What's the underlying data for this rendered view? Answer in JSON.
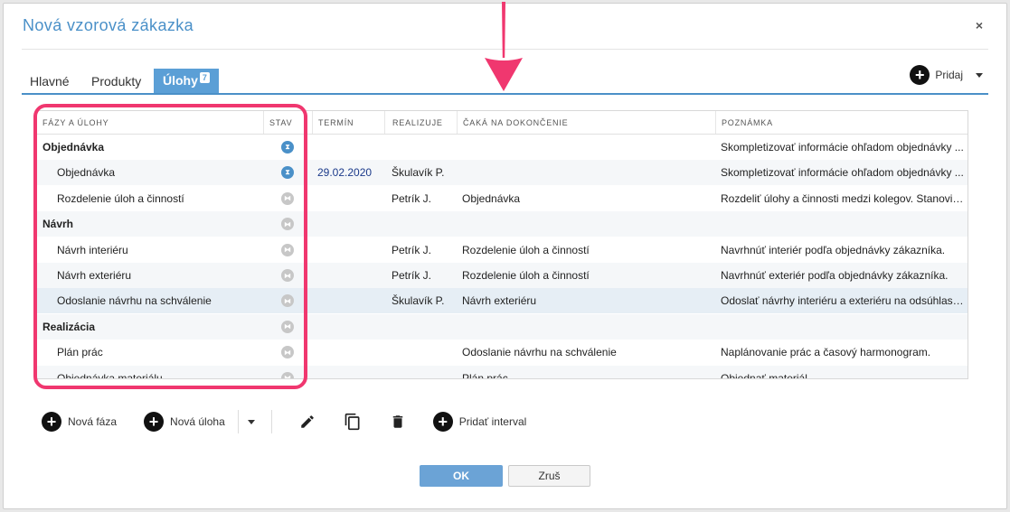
{
  "dialog": {
    "title": "Nová vzorová zákazka",
    "close_label": "×"
  },
  "tabs": [
    {
      "label": "Hlavné"
    },
    {
      "label": "Produkty"
    },
    {
      "label": "Úlohy",
      "badge": "7",
      "active": true
    }
  ],
  "add_menu": {
    "label": "Pridaj",
    "icon": "plus-circle-icon"
  },
  "grid": {
    "columns": [
      "FÁZY A ÚLOHY",
      "STAV",
      "TERMÍN",
      "REALIZUJE",
      "ČAKÁ NA DOKONČENIE",
      "POZNÁMKA"
    ],
    "rows": [
      {
        "type": "phase",
        "name": "Objednávka",
        "status": "active",
        "date": "",
        "assignee": "",
        "waits_for": "",
        "note": "Skompletizovať informácie ohľadom objednávky ..."
      },
      {
        "type": "task",
        "name": "Objednávka",
        "status": "active",
        "date": "29.02.2020",
        "assignee": "Škulavík P.",
        "waits_for": "",
        "note": "Skompletizovať informácie ohľadom objednávky ..."
      },
      {
        "type": "task",
        "name": "Rozdelenie úloh a činností",
        "status": "waiting",
        "date": "",
        "assignee": "Petrík J.",
        "waits_for": "Objednávka",
        "note": "Rozdeliť úlohy a činnosti medzi kolegov. Stanoviť ..."
      },
      {
        "type": "phase",
        "name": "Návrh",
        "status": "waiting",
        "date": "",
        "assignee": "",
        "waits_for": "",
        "note": ""
      },
      {
        "type": "task",
        "name": "Návrh interiéru",
        "status": "waiting",
        "date": "",
        "assignee": "Petrík J.",
        "waits_for": "Rozdelenie úloh a činností",
        "note": "Navrhnúť interiér podľa objednávky zákazníka."
      },
      {
        "type": "task",
        "name": "Návrh exteriéru",
        "status": "waiting",
        "date": "",
        "assignee": "Petrík J.",
        "waits_for": "Rozdelenie úloh a činností",
        "note": "Navrhnúť exteriér podľa objednávky zákazníka."
      },
      {
        "type": "task",
        "name": "Odoslanie návrhu na schválenie",
        "status": "waiting",
        "date": "",
        "assignee": "Škulavík P.",
        "waits_for": "Návrh exteriéru",
        "note": "Odoslať návrhy interiéru a exteriéru na odsúhlase..."
      },
      {
        "type": "phase",
        "name": "Realizácia",
        "status": "waiting",
        "date": "",
        "assignee": "",
        "waits_for": "",
        "note": ""
      },
      {
        "type": "task",
        "name": "Plán prác",
        "status": "waiting",
        "date": "",
        "assignee": "",
        "waits_for": "Odoslanie návrhu na schválenie",
        "note": "Naplánovanie prác a časový harmonogram."
      },
      {
        "type": "task",
        "name": "Objednávka materiálu",
        "status": "waiting",
        "date": "",
        "assignee": "",
        "waits_for": "Plán prác",
        "note": "Objednať materiál."
      }
    ]
  },
  "toolbar": {
    "new_phase": "Nová fáza",
    "new_task": "Nová úloha",
    "edit_icon": "pencil-icon",
    "copy_icon": "copy-icon",
    "delete_icon": "trash-icon",
    "add_interval": "Pridať interval"
  },
  "buttons": {
    "ok": "OK",
    "cancel": "Zruš"
  },
  "colors": {
    "accent": "#4a90c8",
    "highlight": "#f0376f",
    "status_active": "#4a90c8",
    "status_waiting": "#c7c7c7"
  }
}
